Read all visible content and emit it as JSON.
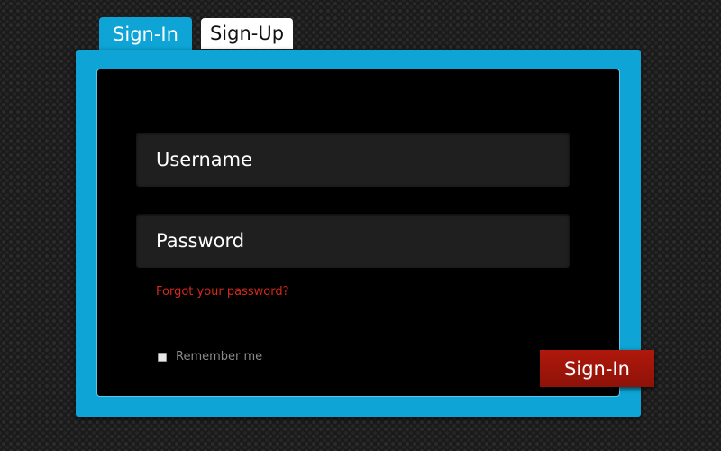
{
  "tabs": {
    "signin": "Sign-In",
    "signup": "Sign-Up"
  },
  "form": {
    "username_placeholder": "Username",
    "password_placeholder": "Password",
    "forgot_password": "Forgot your password?",
    "remember_me": "Remember me",
    "remember_checked": false,
    "submit_label": "Sign-In"
  },
  "colors": {
    "accent": "#0ea5d6",
    "button": "#a8150b",
    "link": "#d42a1c",
    "panel": "#000000"
  }
}
